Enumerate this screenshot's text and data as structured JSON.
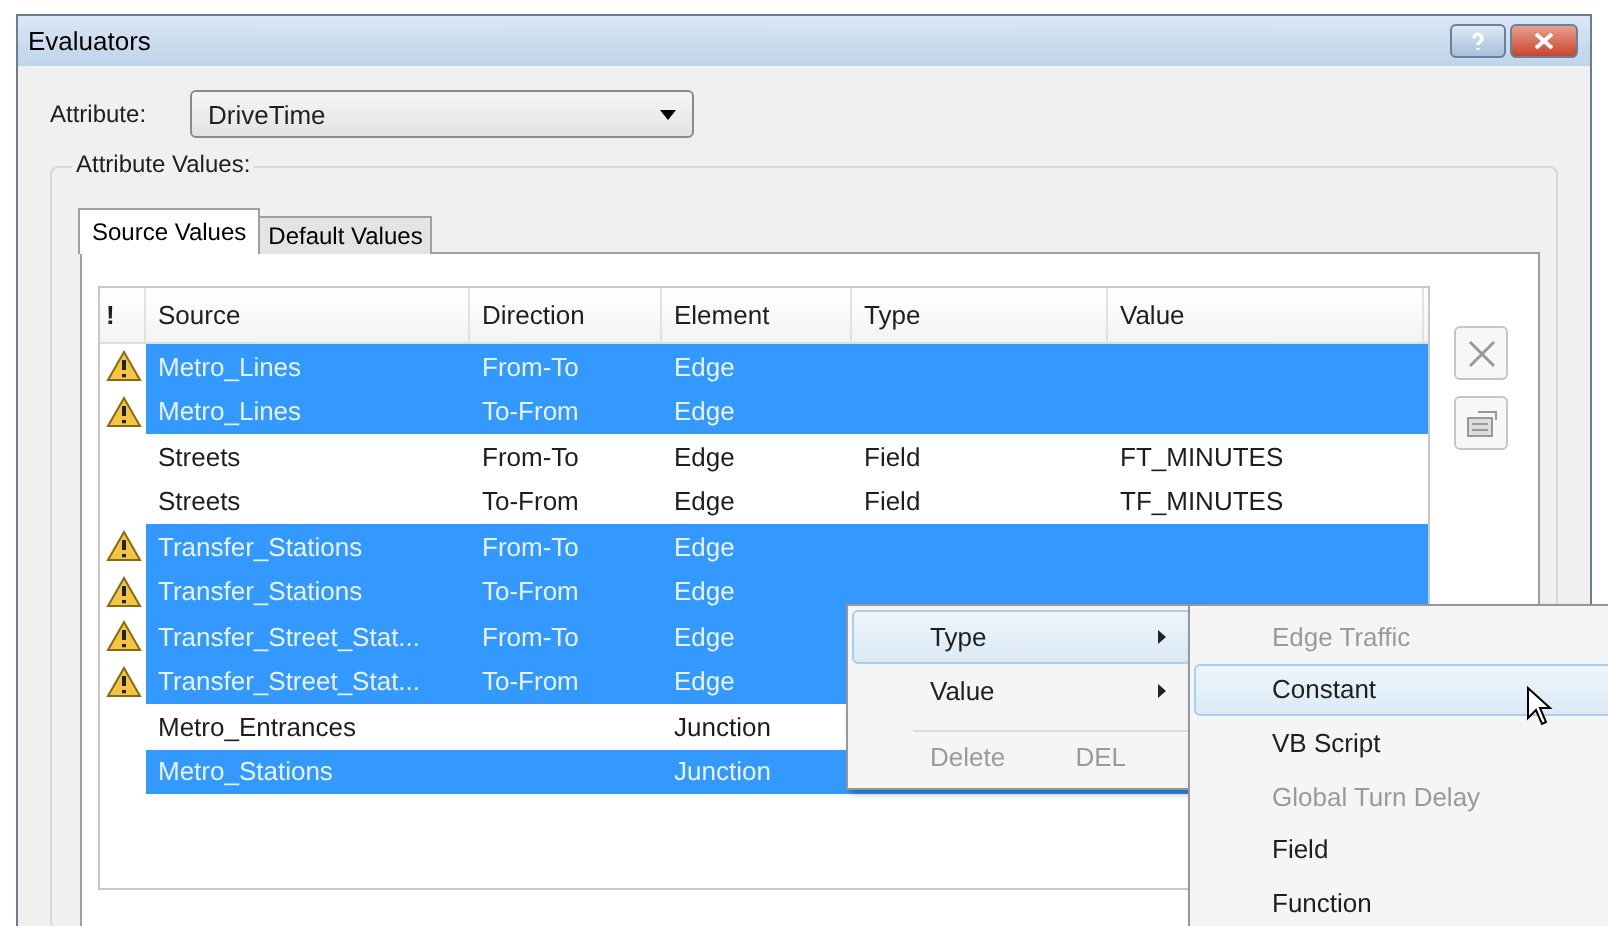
{
  "window": {
    "title": "Evaluators"
  },
  "attribute": {
    "label": "Attribute:",
    "value": "DriveTime"
  },
  "group": {
    "label": "Attribute Values:"
  },
  "tabs": [
    {
      "label": "Source Values",
      "selected": true
    },
    {
      "label": "Default Values",
      "selected": false
    }
  ],
  "table": {
    "columns": [
      "!",
      "Source",
      "Direction",
      "Element",
      "Type",
      "Value"
    ],
    "rows": [
      {
        "warning": true,
        "selected": true,
        "source": "Metro_Lines",
        "direction": "From-To",
        "element": "Edge"
      },
      {
        "warning": true,
        "selected": true,
        "source": "Metro_Lines",
        "direction": "To-From",
        "element": "Edge"
      },
      {
        "warning": false,
        "selected": false,
        "source": "Streets",
        "direction": "From-To",
        "element": "Edge",
        "type": "Field",
        "value": "FT_MINUTES"
      },
      {
        "warning": false,
        "selected": false,
        "source": "Streets",
        "direction": "To-From",
        "element": "Edge",
        "type": "Field",
        "value": "TF_MINUTES"
      },
      {
        "warning": true,
        "selected": true,
        "source": "Transfer_Stations",
        "direction": "From-To",
        "element": "Edge"
      },
      {
        "warning": true,
        "selected": true,
        "source": "Transfer_Stations",
        "direction": "To-From",
        "element": "Edge"
      },
      {
        "warning": true,
        "selected": true,
        "source": "Transfer_Street_Stat...",
        "direction": "From-To",
        "element": "Edge"
      },
      {
        "warning": true,
        "selected": true,
        "source": "Transfer_Street_Stat...",
        "direction": "To-From",
        "element": "Edge"
      },
      {
        "warning": false,
        "selected": false,
        "source": "Metro_Entrances",
        "element": "Junction"
      },
      {
        "warning": false,
        "selected": true,
        "source": "Metro_Stations",
        "element": "Junction"
      }
    ]
  },
  "context_menu": {
    "items": [
      {
        "label": "Type",
        "submenu": true,
        "selected": true,
        "disabled": false,
        "separator_before": false
      },
      {
        "label": "Value",
        "submenu": true,
        "selected": false,
        "disabled": false,
        "separator_before": false
      },
      {
        "label": "Delete",
        "shortcut": "DEL",
        "submenu": false,
        "selected": false,
        "disabled": true,
        "separator_before": true
      }
    ]
  },
  "submenu": {
    "items": [
      {
        "label": "Edge Traffic",
        "selected": false,
        "disabled": true
      },
      {
        "label": "Constant",
        "selected": true,
        "disabled": false
      },
      {
        "label": "VB Script",
        "selected": false,
        "disabled": false
      },
      {
        "label": "Global Turn Delay",
        "selected": false,
        "disabled": true
      },
      {
        "label": "Field",
        "selected": false,
        "disabled": false
      },
      {
        "label": "Function",
        "selected": false,
        "disabled": false
      }
    ]
  }
}
